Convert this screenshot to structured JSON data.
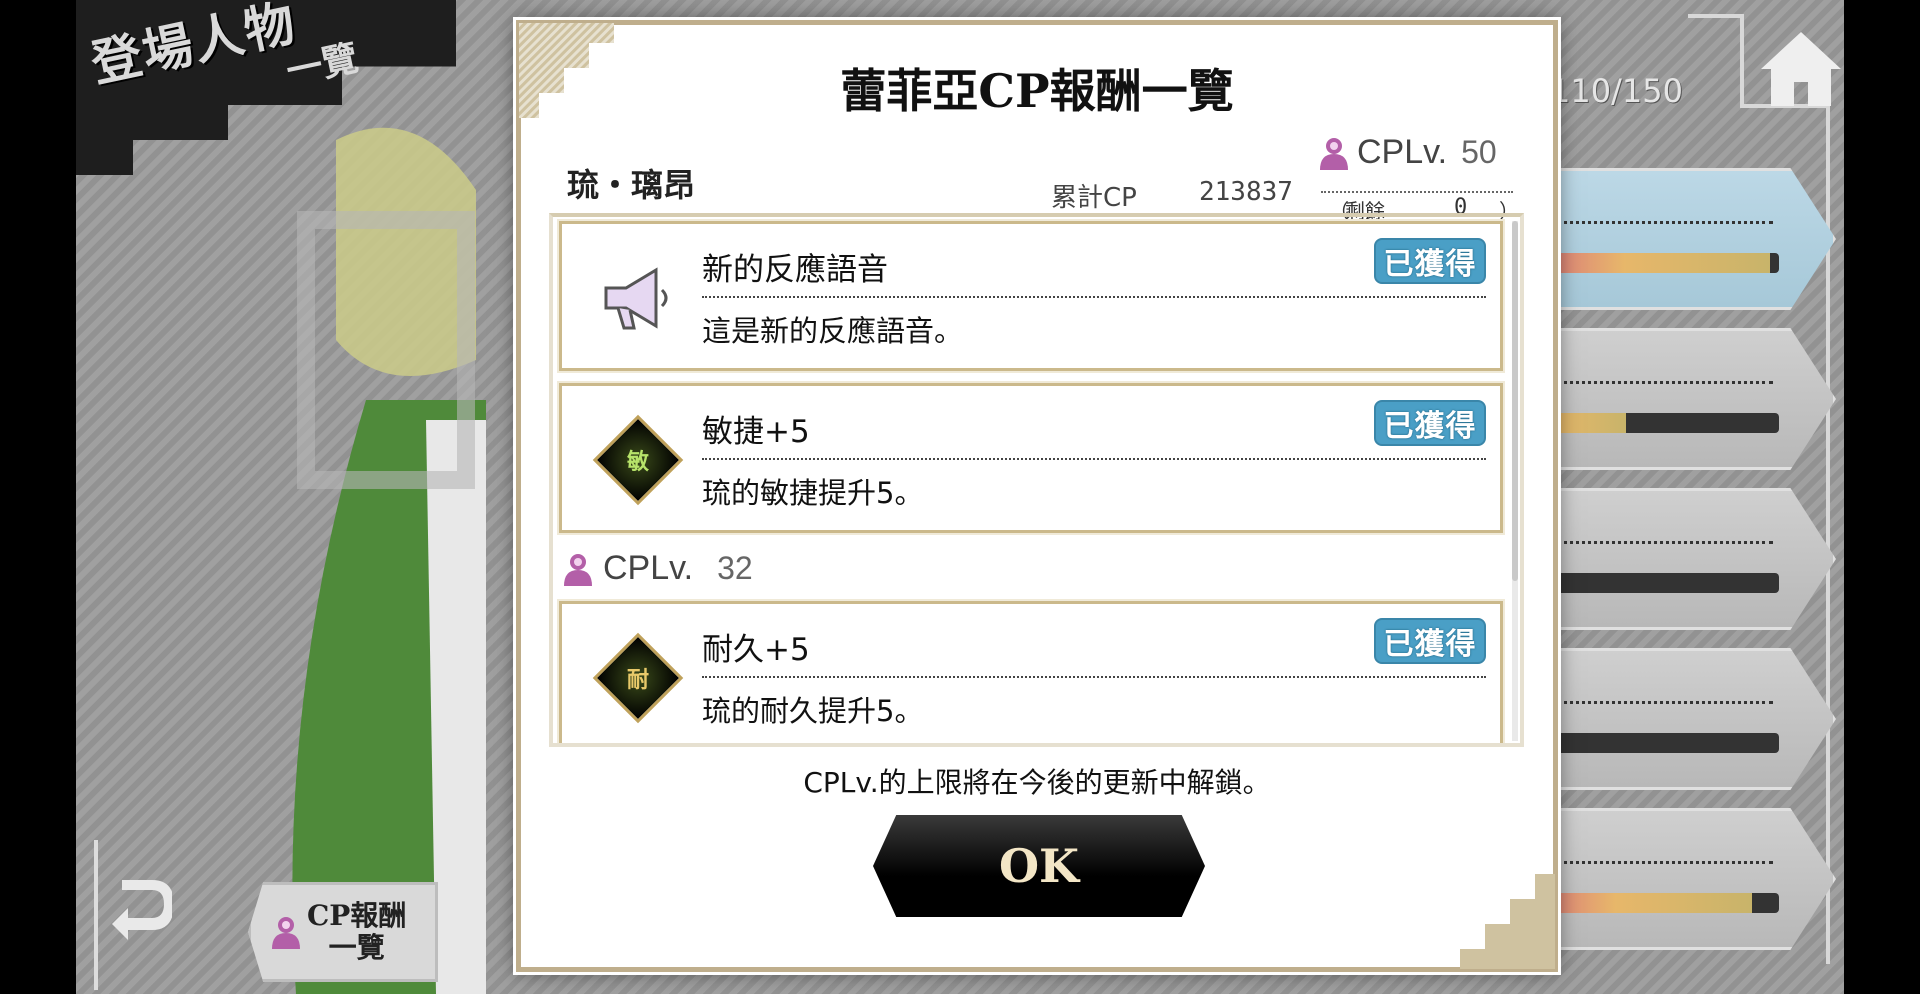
{
  "background": {
    "banner_title": "登場人物",
    "banner_sub": "一覽",
    "member_count": "110/150",
    "cp_list_button": {
      "line1": "CP報酬",
      "line2": "一覽"
    },
    "list_bars": [
      0.97,
      0.49,
      0.0,
      0.0,
      0.91
    ]
  },
  "modal": {
    "title": "蕾菲亞CP報酬一覽",
    "character_name": "琉・璃昂",
    "cp_total_label": "累計CP",
    "cp_total_value": "213837",
    "cplv_label": "CPLv.",
    "cplv_value": "50",
    "remain_open": "（",
    "remain_label": "剩餘",
    "remain_value": "0",
    "remain_close": "）",
    "rewards": [
      {
        "icon": "megaphone-icon",
        "title": "新的反應語音",
        "description": "這是新的反應語音。",
        "badge": "已獲得"
      },
      {
        "icon": "agility-diamond-icon",
        "icon_char": "敏",
        "title": "敏捷+5",
        "description": "琉的敏捷提升5。",
        "badge": "已獲得"
      },
      {
        "icon": "endurance-diamond-icon",
        "icon_char": "耐",
        "title": "耐久+5",
        "description": "琉的耐久提升5。",
        "badge": "已獲得"
      }
    ],
    "level_group": {
      "label": "CPLv.",
      "value": "32"
    },
    "unlock_note": "CPLv.的上限將在今後的更新中解鎖。",
    "ok_label": "OK"
  },
  "colors": {
    "badge": "#4a9fc6",
    "modal_border": "#bfae8c",
    "cp_icon": "#b35fa8"
  }
}
